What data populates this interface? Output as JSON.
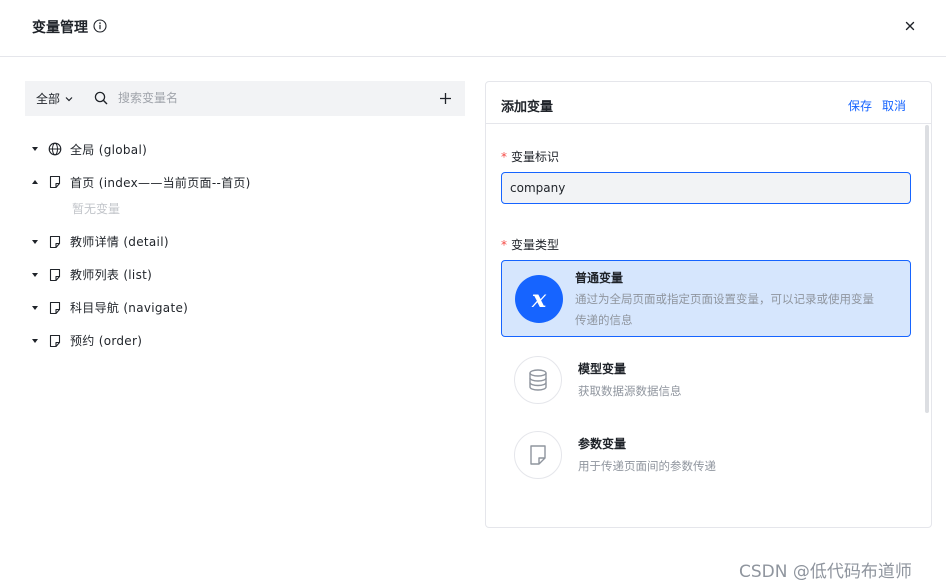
{
  "dialog": {
    "title": "变量管理",
    "info_icon": "info-circle-icon",
    "close_icon": "close-icon"
  },
  "toolbar": {
    "filter_label": "全部",
    "search_placeholder": "搜索变量名",
    "add_icon": "plus-icon"
  },
  "tree": {
    "nodes": [
      {
        "label": "全局 (global)",
        "icon": "globe-icon",
        "expanded": false
      },
      {
        "label": "首页 (index——当前页面--首页)",
        "icon": "page-icon",
        "expanded": true,
        "empty_text": "暂无变量"
      },
      {
        "label": "教师详情 (detail)",
        "icon": "page-icon",
        "expanded": false
      },
      {
        "label": "教师列表 (list)",
        "icon": "page-icon",
        "expanded": false
      },
      {
        "label": "科目导航 (navigate)",
        "icon": "page-icon",
        "expanded": false
      },
      {
        "label": "预约 (order)",
        "icon": "page-icon",
        "expanded": false
      }
    ]
  },
  "panel": {
    "title": "添加变量",
    "save_label": "保存",
    "cancel_label": "取消",
    "id_label": "变量标识",
    "id_value": "company",
    "type_label": "变量类型",
    "types": [
      {
        "name": "普通变量",
        "desc_line1": "通过为全局页面或指定页面设置变量，可以记录或使用变量",
        "desc_line2": "传递的信息",
        "icon": "variable-x-icon",
        "selected": true
      },
      {
        "name": "模型变量",
        "desc_line1": "获取数据源数据信息",
        "icon": "database-icon",
        "selected": false
      },
      {
        "name": "参数变量",
        "desc_line1": "用于传递页面间的参数传递",
        "icon": "page-param-icon",
        "selected": false
      }
    ]
  },
  "watermark": "CSDN @低代码布道师",
  "colors": {
    "accent": "#1664ff",
    "selected_bg": "#d6e6fd",
    "required": "#f54a45"
  }
}
